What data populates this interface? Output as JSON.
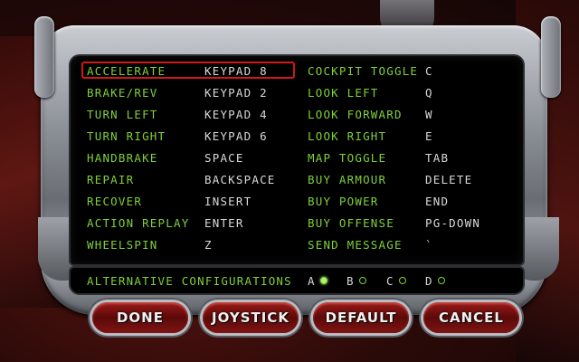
{
  "controls_left": [
    {
      "action": "Accelerate",
      "key": "Keypad 8",
      "selected": true
    },
    {
      "action": "Brake/Rev",
      "key": "Keypad 2"
    },
    {
      "action": "Turn Left",
      "key": "Keypad 4"
    },
    {
      "action": "Turn Right",
      "key": "Keypad 6"
    },
    {
      "action": "Handbrake",
      "key": "Space"
    },
    {
      "action": "Repair",
      "key": "Backspace"
    },
    {
      "action": "Recover",
      "key": "Insert"
    },
    {
      "action": "Action Replay",
      "key": "Enter"
    },
    {
      "action": "Wheelspin",
      "key": "Z"
    }
  ],
  "controls_right": [
    {
      "action": "Cockpit Toggle",
      "key": "C"
    },
    {
      "action": "Look Left",
      "key": "Q"
    },
    {
      "action": "Look Forward",
      "key": "W"
    },
    {
      "action": "Look Right",
      "key": "E"
    },
    {
      "action": "Map Toggle",
      "key": "Tab"
    },
    {
      "action": "Buy Armour",
      "key": "Delete"
    },
    {
      "action": "Buy Power",
      "key": "End"
    },
    {
      "action": "Buy Offense",
      "key": "PG-Down"
    },
    {
      "action": "Send Message",
      "key": "`"
    }
  ],
  "alternatives": {
    "label": "Alternative configurations",
    "options": [
      {
        "name": "A",
        "selected": true
      },
      {
        "name": "B",
        "selected": false
      },
      {
        "name": "C",
        "selected": false
      },
      {
        "name": "D",
        "selected": false
      }
    ]
  },
  "buttons": {
    "done": "DONE",
    "joystick": "JOYSTICK",
    "default": "DEFAULT",
    "cancel": "CANCEL"
  },
  "colors": {
    "label_green": "#7fd03b",
    "key_white": "#d8d8d8",
    "selection_red": "#d21616",
    "button_red": "#7e1412"
  }
}
